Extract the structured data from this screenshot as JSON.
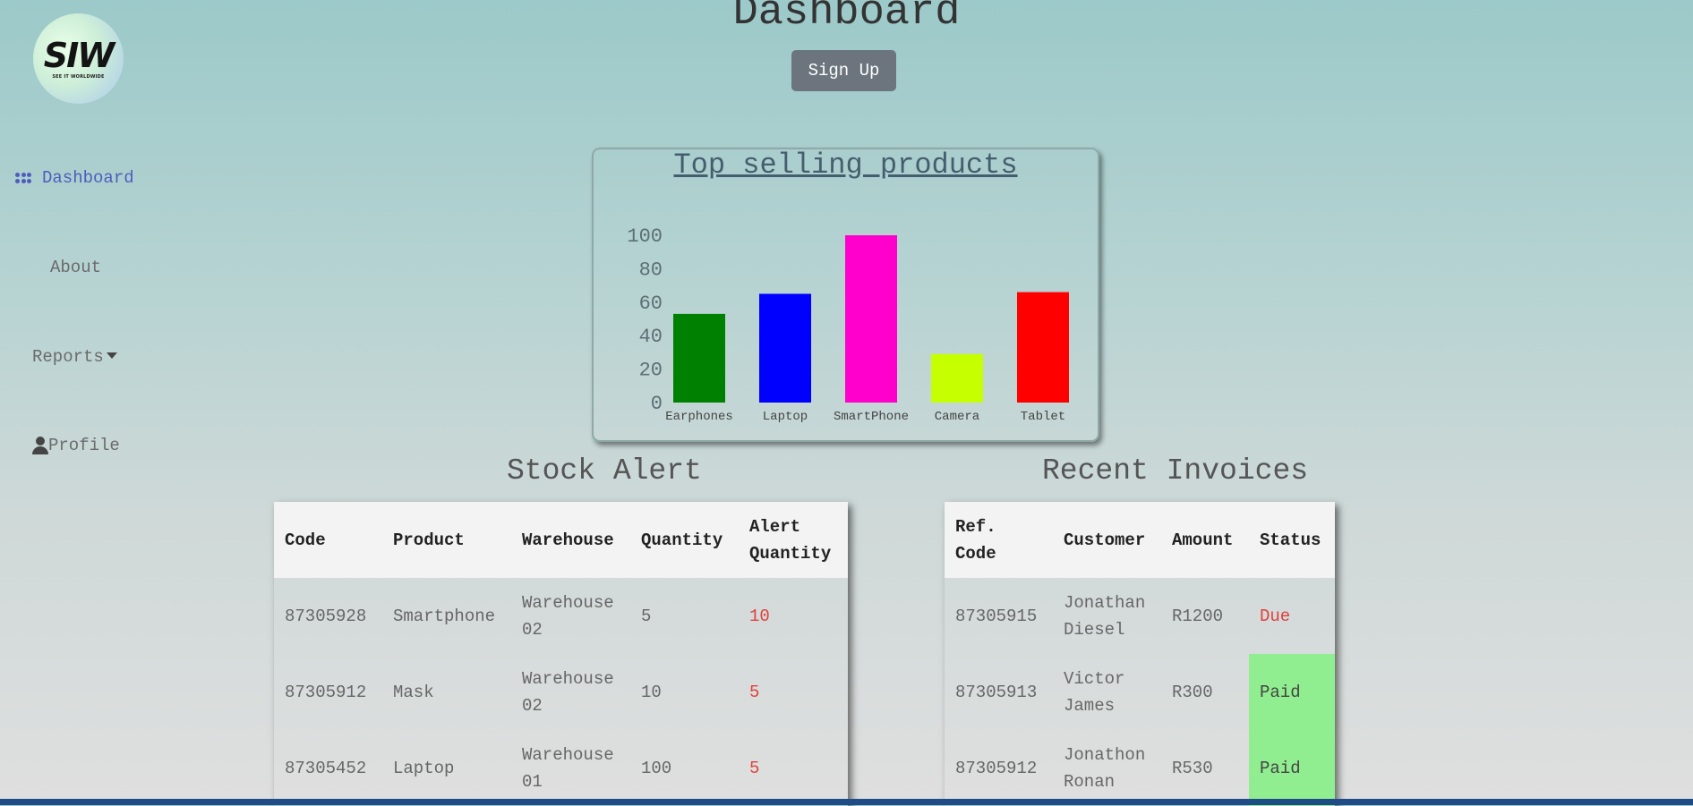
{
  "logo": {
    "text": "SIW",
    "subtitle": "SEE IT WORLDWIDE"
  },
  "nav": {
    "dashboard": "Dashboard",
    "about": "About",
    "reports": "Reports",
    "profile": "Profile"
  },
  "header": {
    "title": "Dashboard",
    "signup_label": "Sign Up"
  },
  "chart_data": {
    "type": "bar",
    "title": "Top selling products",
    "categories": [
      "Earphones",
      "Laptop",
      "SmartPhone",
      "Camera",
      "Tablet"
    ],
    "values": [
      53,
      65,
      100,
      29,
      66
    ],
    "colors": [
      "#008000",
      "#0000ff",
      "#ff00cc",
      "#c6ff00",
      "#ff0000"
    ],
    "ylim": [
      0,
      100
    ],
    "yticks": [
      0,
      20,
      40,
      60,
      80,
      100
    ],
    "xlabel": "",
    "ylabel": ""
  },
  "stock": {
    "title": "Stock Alert",
    "headers": [
      "Code",
      "Product",
      "Warehouse",
      "Quantity",
      "Alert Quantity"
    ],
    "rows": [
      [
        "87305928",
        "Smartphone",
        "Warehouse 02",
        "5",
        "10"
      ],
      [
        "87305912",
        "Mask",
        "Warehouse 02",
        "10",
        "5"
      ],
      [
        "87305452",
        "Laptop",
        "Warehouse 01",
        "100",
        "5"
      ]
    ]
  },
  "invoices": {
    "title": "Recent Invoices",
    "headers": [
      "Ref. Code",
      "Customer",
      "Amount",
      "Status"
    ],
    "rows": [
      [
        "87305915",
        "Jonathan Diesel",
        "R1200",
        "Due"
      ],
      [
        "87305913",
        "Victor James",
        "R300",
        "Paid"
      ],
      [
        "87305912",
        "Jonathon Ronan",
        "R530",
        "Paid"
      ]
    ]
  }
}
